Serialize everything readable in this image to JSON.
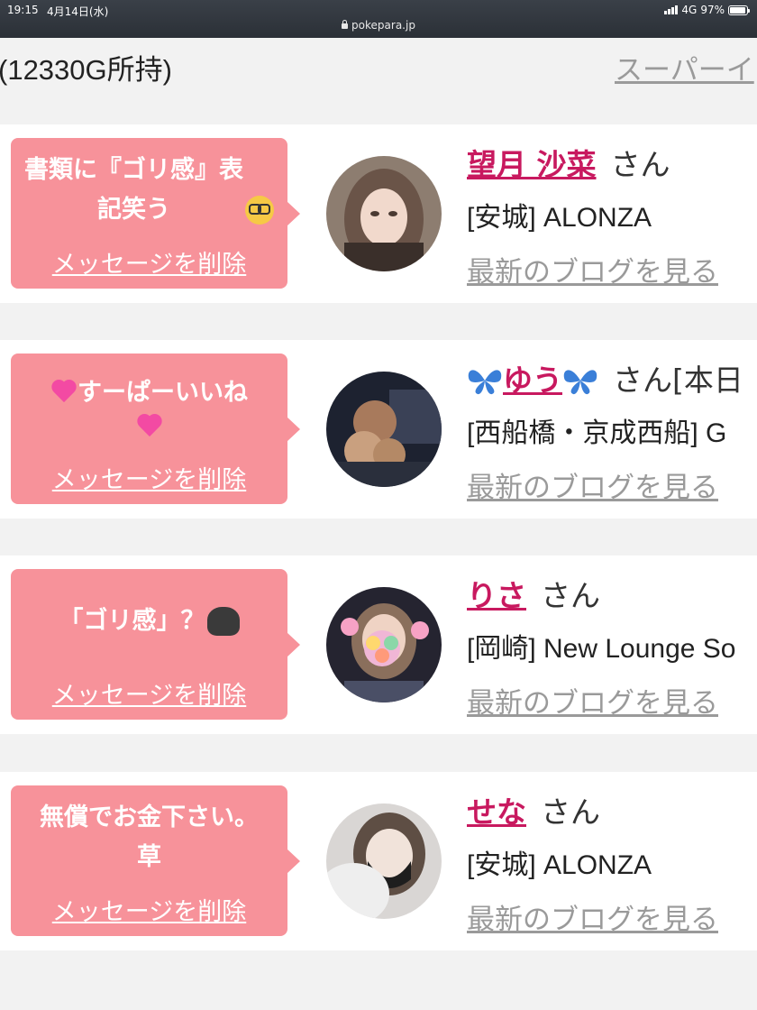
{
  "status_bar": {
    "time": "19:15",
    "date": "4月14日(水)",
    "network": "4G",
    "battery": "97%",
    "battery_level": 0.97,
    "url": "pokepara.jp"
  },
  "header": {
    "points": "(12330G所持)",
    "super_link": "スーパーイ"
  },
  "messages": [
    {
      "text": "書類に『ゴリ感』表\n記笑う",
      "emoji": "nerd-face-icon",
      "delete_label": "メッセージを削除",
      "cast_name": "望月 沙菜",
      "suffix": "さん",
      "shop": "[安城] ALONZA",
      "blog_link": "最新のブログを見る"
    },
    {
      "text": "すーぱーいいね",
      "emoji": "heart-icon",
      "delete_label": "メッセージを削除",
      "cast_name": "ゆう",
      "suffix": "さん[本日",
      "shop": "[西船橋・京成西船] G",
      "blog_link": "最新のブログを見る"
    },
    {
      "text": "「ゴリ感」？",
      "emoji": "gorilla-icon",
      "delete_label": "メッセージを削除",
      "cast_name": "りさ",
      "suffix": "さん",
      "shop": "[岡崎] New Lounge So",
      "blog_link": "最新のブログを見る"
    },
    {
      "text": "無償でお金下さい。\n草",
      "emoji": "",
      "delete_label": "メッセージを削除",
      "cast_name": "せな",
      "suffix": "さん",
      "shop": "[安城] ALONZA",
      "blog_link": "最新のブログを見る"
    }
  ],
  "colors": {
    "bubble": "#f7929a",
    "cast_name": "#c8195f",
    "link_gray": "#9a9a9a",
    "background": "#f2f2f2"
  }
}
